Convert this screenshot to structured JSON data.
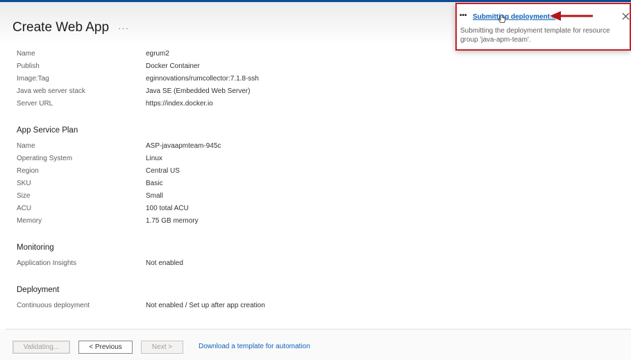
{
  "header": {
    "title": "Create Web App",
    "more": "···"
  },
  "details": [
    {
      "label": "Name",
      "value": "egrum2"
    },
    {
      "label": "Publish",
      "value": "Docker Container"
    },
    {
      "label": "Image:Tag",
      "value": "eginnovations/rumcollector:7.1.8-ssh"
    },
    {
      "label": "Java web server stack",
      "value": "Java SE (Embedded Web Server)"
    },
    {
      "label": "Server URL",
      "value": "https://index.docker.io"
    }
  ],
  "plan": {
    "title": "App Service Plan",
    "rows": [
      {
        "label": "Name",
        "value": "ASP-javaapmteam-945c"
      },
      {
        "label": "Operating System",
        "value": "Linux"
      },
      {
        "label": "Region",
        "value": "Central US"
      },
      {
        "label": "SKU",
        "value": "Basic"
      },
      {
        "label": "Size",
        "value": "Small"
      },
      {
        "label": "ACU",
        "value": "100 total ACU"
      },
      {
        "label": "Memory",
        "value": "1.75 GB memory"
      }
    ]
  },
  "monitoring": {
    "title": "Monitoring",
    "rows": [
      {
        "label": "Application Insights",
        "value": "Not enabled"
      }
    ]
  },
  "deployment": {
    "title": "Deployment",
    "rows": [
      {
        "label": "Continuous deployment",
        "value": "Not enabled / Set up after app creation"
      }
    ]
  },
  "footer": {
    "validating": "Validating...",
    "previous": "< Previous",
    "next": "Next >",
    "automation_link": "Download a template for automation"
  },
  "notification": {
    "dots": "•••",
    "title": "Submitting deployment...",
    "message": "Submitting the deployment template for resource group 'java-apm-team'."
  },
  "colors": {
    "accent": "#0f62b8",
    "highlight": "#c41e24",
    "top_strip": "#0f4c97"
  },
  "icons": {
    "close": "close-icon",
    "more": "more-icon",
    "cursor": "hand-cursor-icon",
    "annotation": "red-arrow-icon"
  }
}
